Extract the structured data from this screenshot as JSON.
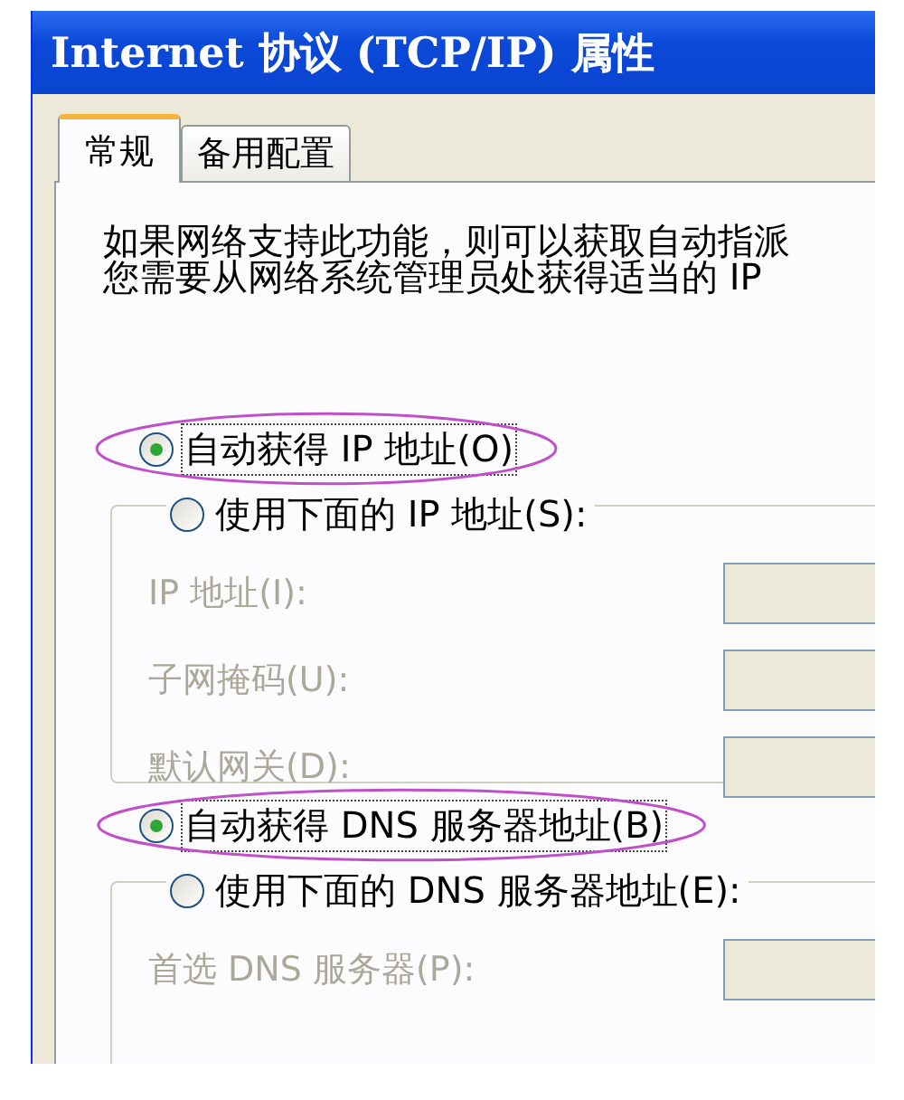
{
  "window": {
    "title": "Internet 协议 (TCP/IP) 属性"
  },
  "tabs": [
    {
      "label": "常规",
      "selected": true
    },
    {
      "label": "备用配置",
      "selected": false
    }
  ],
  "intro": [
    "如果网络支持此功能，则可以获取自动指派",
    "您需要从网络系统管理员处获得适当的 IP"
  ],
  "ip_mode": {
    "options": [
      {
        "label": "自动获得 IP 地址(O)",
        "selected": true,
        "highlighted": true
      },
      {
        "label": "使用下面的 IP 地址(S):",
        "selected": false,
        "highlighted": false
      }
    ],
    "fields": [
      {
        "label": "IP 地址(I):",
        "disabled": true
      },
      {
        "label": "子网掩码(U):",
        "disabled": true
      },
      {
        "label": "默认网关(D):",
        "disabled": true
      }
    ]
  },
  "dns_mode": {
    "options": [
      {
        "label": "自动获得 DNS 服务器地址(B)",
        "selected": true,
        "highlighted": true
      },
      {
        "label": "使用下面的 DNS 服务器地址(E):",
        "selected": false,
        "highlighted": false
      }
    ],
    "fields": [
      {
        "label": "首选 DNS 服务器(P):",
        "disabled": true
      }
    ]
  }
}
